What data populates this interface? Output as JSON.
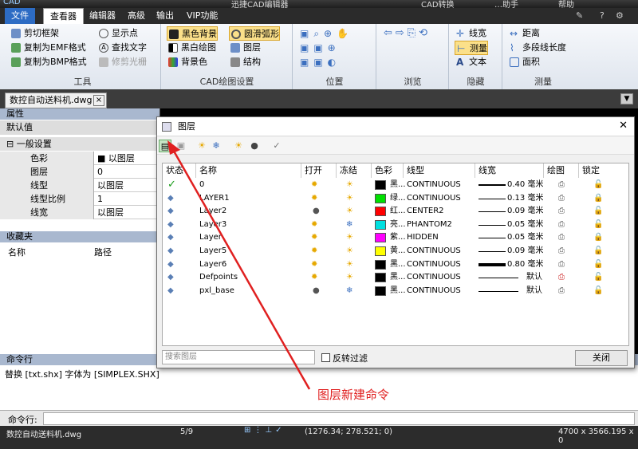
{
  "title": {
    "app_icon": "CAD",
    "window_title": "迅捷CAD编辑器",
    "top_right": [
      "CAD转换",
      "…助手",
      "帮助"
    ]
  },
  "menu": [
    "文件",
    "查看器",
    "编辑器",
    "高级",
    "输出",
    "VIP功能"
  ],
  "ribbon": {
    "groups": [
      {
        "title": "工具",
        "items": [
          "剪切框架",
          "复制为EMF格式",
          "复制为BMP格式",
          "显示点",
          "查找文字",
          "修剪光栅"
        ]
      },
      {
        "title": "CAD绘图设置",
        "items": [
          "黑色背景",
          "黑白绘图",
          "背景色",
          "圆滑弧形",
          "图层",
          "结构"
        ]
      },
      {
        "title": "位置",
        "items": []
      },
      {
        "title": "浏览",
        "items": []
      },
      {
        "title": "隐藏",
        "items": [
          "线宽",
          "测量",
          "文本"
        ]
      },
      {
        "title": "测量",
        "items": [
          "距离",
          "多段线长度",
          "面积"
        ]
      }
    ]
  },
  "doc_tab": "数控自动送料机.dwg",
  "properties": {
    "header": "属性",
    "default": "默认值",
    "section": "一般设置",
    "rows": [
      {
        "k": "色彩",
        "v": "以图层"
      },
      {
        "k": "图层",
        "v": "0"
      },
      {
        "k": "线型",
        "v": "以图层"
      },
      {
        "k": "线型比例",
        "v": "1"
      },
      {
        "k": "线宽",
        "v": "以图层"
      }
    ]
  },
  "favorites": {
    "header": "收藏夹",
    "cols": [
      "名称",
      "路径"
    ]
  },
  "command": {
    "header": "命令行",
    "log": "替换 [txt.shx] 字体为 [SIMPLEX.SHX]",
    "prompt": "命令行:"
  },
  "status": {
    "file": "数控自动送料机.dwg",
    "page": "5/9",
    "coords": "(1276.34; 278.521; 0)",
    "size": "4700 x 3566.195 x 0"
  },
  "dialog": {
    "title": "图层",
    "columns": [
      "状态",
      "名称",
      "打开",
      "冻结",
      "色彩",
      "线型",
      "线宽",
      "绘图",
      "锁定"
    ],
    "layers": [
      {
        "state": "current",
        "name": "0",
        "on": true,
        "frozen": false,
        "color": "#000000",
        "color_name": "黑...",
        "linetype": "CONTINUOUS",
        "lw": "0.40 毫米",
        "plot": true,
        "lock": "unlocked"
      },
      {
        "state": "layer",
        "name": "LAYER1",
        "on": true,
        "frozen": false,
        "color": "#00e000",
        "color_name": "绿...",
        "linetype": "CONTINUOUS",
        "lw": "0.13 毫米",
        "plot": true,
        "lock": "locked"
      },
      {
        "state": "layer",
        "name": "Layer2",
        "on": false,
        "frozen": false,
        "color": "#ff0000",
        "color_name": "红...",
        "linetype": "CENTER2",
        "lw": "0.09 毫米",
        "plot": true,
        "lock": "unlocked"
      },
      {
        "state": "layer",
        "name": "Layer3",
        "on": true,
        "frozen": true,
        "color": "#00e0e0",
        "color_name": "亮...",
        "linetype": "PHANTOM2",
        "lw": "0.05 毫米",
        "plot": true,
        "lock": "unlocked"
      },
      {
        "state": "layer",
        "name": "Layer",
        "on": true,
        "frozen": false,
        "color": "#ff00ff",
        "color_name": "紫...",
        "linetype": "HIDDEN",
        "lw": "0.05 毫米",
        "plot": true,
        "lock": "locked"
      },
      {
        "state": "layer",
        "name": "Layer5",
        "on": true,
        "frozen": false,
        "color": "#ffff00",
        "color_name": "黄...",
        "linetype": "CONTINUOUS",
        "lw": "0.09 毫米",
        "plot": true,
        "lock": "unlocked"
      },
      {
        "state": "layer",
        "name": "Layer6",
        "on": true,
        "frozen": false,
        "color": "#000000",
        "color_name": "黑...",
        "linetype": "CONTINUOUS",
        "lw": "0.80 毫米",
        "plot": true,
        "lock": "unlocked"
      },
      {
        "state": "layer",
        "name": "Defpoints",
        "on": true,
        "frozen": false,
        "color": "#000000",
        "color_name": "黑...",
        "linetype": "CONTINUOUS",
        "lw": "默认",
        "plot": false,
        "lock": "unlocked"
      },
      {
        "state": "layer",
        "name": "pxl_base",
        "on": false,
        "frozen": true,
        "color": "#000000",
        "color_name": "黑...",
        "linetype": "CONTINUOUS",
        "lw": "默认",
        "plot": true,
        "lock": "unlocked"
      }
    ],
    "search_placeholder": "搜索图层",
    "invert_filter": "反转过滤",
    "close": "关闭"
  },
  "annotation": "图层新建命令",
  "colors": {
    "annotation": "#e02020"
  }
}
